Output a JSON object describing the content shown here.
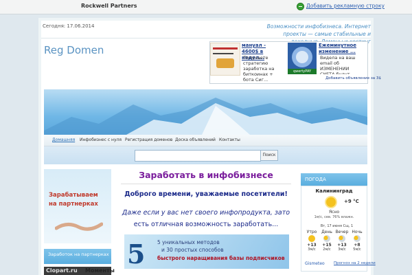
{
  "topbar": {
    "brand": "Rockwell Partners",
    "add_link": "Добавить рекламную строку",
    "add_icon": "plus-circle-icon"
  },
  "header": {
    "date": "Сегодня: 17.06.2014",
    "slogan": "Возможности инфобизнеса. Интернет проекты — самые стабильные и доходные. Домены и хостинг",
    "logo": "Reg Domen"
  },
  "ads": [
    {
      "title": "мануал - 4600$ в недел...",
      "text": "Получаете стратегию заработка на биткоинах + бота Сиг..."
    },
    {
      "title": "Ежеминутное изменение ...",
      "text": "Видела на ваш email об ИЗМЕНЕНИИ СЧЕТА будут"
    }
  ],
  "ad_footer": "Добавить объявление за 3$",
  "ad2_badge": "qwertyPAY",
  "nav": [
    "Домашняя",
    "Инфобизнес с нуля",
    "Регистрация доменов",
    "Доска объявлений",
    "Контакты"
  ],
  "search": {
    "button": "Поиск",
    "placeholder": ""
  },
  "left": {
    "promo_line1": "Зарабатываем",
    "promo_line2": "на партнерках",
    "widget_title": "Заработок на партнерках",
    "item_logo": "Clopart.ru",
    "item_text": "Моменты"
  },
  "main": {
    "title": "Заработать в инфобизнесе",
    "greeting": "Доброго времени, уважаемые посетители!",
    "p1": "Даже если у вас нет своего инфопродукта, зато",
    "p2": "есть отличная  возможность заработать...",
    "promo": {
      "number": "5",
      "line1": "5 уникальных методов",
      "line2": "и 30 простых способов",
      "line3": "быстрого наращивания базы подписчиков"
    }
  },
  "weather": {
    "title": "ПОГОДА",
    "city": "Калининград",
    "temp": "+9 °C",
    "desc": "Ясно",
    "details": "1м/с, сев.  76% влажн.",
    "date": "Вт, 17 июня         Сщ, 1",
    "cols": [
      {
        "label": "Утро",
        "temp": "+13",
        "wind": "3м/с"
      },
      {
        "label": "День",
        "temp": "+15",
        "wind": "2м/с"
      },
      {
        "label": "Вечер",
        "temp": "+13",
        "wind": "3м/с"
      },
      {
        "label": "Ночь",
        "temp": "+8",
        "wind": "5м/с"
      }
    ],
    "logo": "Gismeteo",
    "link": "Прогноз на 2 недели"
  }
}
